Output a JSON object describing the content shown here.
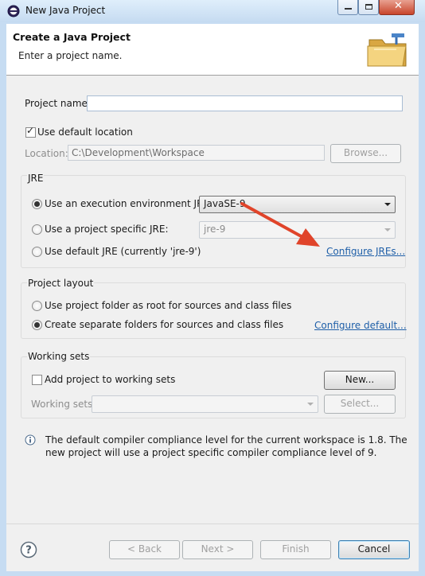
{
  "window": {
    "title": "New Java Project"
  },
  "header": {
    "title": "Create a Java Project",
    "subtitle": "Enter a project name."
  },
  "form": {
    "project_name_label": "Project name:",
    "project_name_value": "",
    "use_default_location_label": "Use default location",
    "use_default_location_checked": true,
    "location_label": "Location:",
    "location_value": "C:\\Development\\Workspace",
    "browse_label": "Browse..."
  },
  "jre": {
    "group_label": "JRE",
    "option_env_label": "Use an execution environment JRE:",
    "option_env_value": "JavaSE-9",
    "option_specific_label": "Use a project specific JRE:",
    "option_specific_value": "jre-9",
    "option_default_label": "Use default JRE (currently 'jre-9')",
    "configure_link": "Configure JREs..."
  },
  "project_layout": {
    "group_label": "Project layout",
    "option_root_label": "Use project folder as root for sources and class files",
    "option_separate_label": "Create separate folders for sources and class files",
    "configure_link": "Configure default..."
  },
  "working_sets": {
    "group_label": "Working sets",
    "add_label": "Add project to working sets",
    "new_label": "New...",
    "sets_label": "Working sets:",
    "select_label": "Select..."
  },
  "info_text": "The default compiler compliance level for the current workspace is 1.8. The new project will use a project specific compiler compliance level of 9.",
  "footer": {
    "back_label": "< Back",
    "next_label": "Next >",
    "finish_label": "Finish",
    "cancel_label": "Cancel"
  },
  "colors": {
    "arrow": "#e0442a",
    "link": "#1f5fa8",
    "title_bar": "#c6dcf2"
  }
}
